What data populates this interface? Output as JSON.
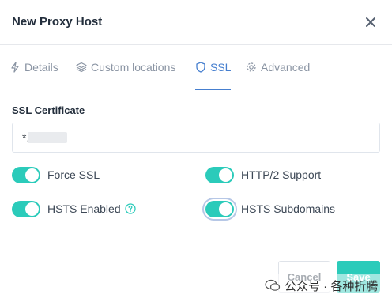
{
  "modal": {
    "title": "New Proxy Host"
  },
  "tabs": [
    {
      "label": "Details",
      "icon": "bolt-icon"
    },
    {
      "label": "Custom locations",
      "icon": "layers-icon"
    },
    {
      "label": "SSL",
      "icon": "shield-icon",
      "active": true
    },
    {
      "label": "Advanced",
      "icon": "gear-icon"
    }
  ],
  "ssl": {
    "certificate_label": "SSL Certificate",
    "certificate_value": "*."
  },
  "toggles": {
    "force_ssl": {
      "label": "Force SSL",
      "on": true
    },
    "http2": {
      "label": "HTTP/2 Support",
      "on": true
    },
    "hsts_enabled": {
      "label": "HSTS Enabled",
      "on": true
    },
    "hsts_subdomains": {
      "label": "HSTS Subdomains",
      "on": true
    }
  },
  "footer": {
    "cancel_label": "Cancel",
    "save_label": "Save"
  },
  "watermark": {
    "text": "公众号 · 各种折腾"
  },
  "colors": {
    "accent": "#467fcf",
    "toggle_on": "#2bcbba",
    "save": "#2bcbba"
  }
}
